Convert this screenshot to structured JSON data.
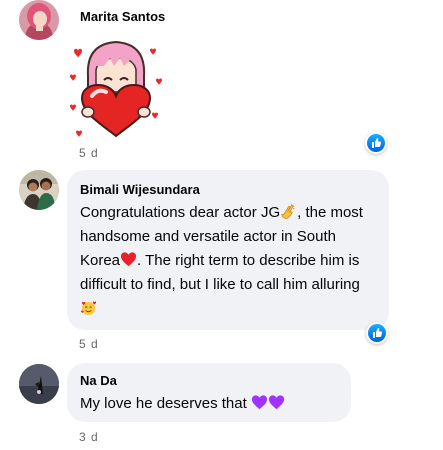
{
  "comments": [
    {
      "author": "Marita Santos",
      "sticker": "heart-hug-sticker",
      "time": "5 d",
      "reaction": "like"
    },
    {
      "author": "Bimali Wijesundara",
      "text_part1": "Congratulations dear actor JG",
      "emoji1": "clapping-hands-emoji",
      "text_part2": ", the most handsome and versatile actor in South Korea",
      "emoji2": "red-heart-emoji",
      "text_part3": ". The right term to describe him is difficult to find, but I like to call him alluring ",
      "emoji3": "smiling-face-with-hearts-emoji",
      "time": "5 d",
      "reaction": "like"
    },
    {
      "author": "Na Da",
      "text_part1": "My love he deserves that ",
      "emoji1": "purple-heart-emoji",
      "time": "3 d"
    }
  ],
  "colors": {
    "bubble": "#f0f2f5",
    "like_blue": "#0866ff",
    "meta_gray": "#65676b",
    "purple_heart": "#a033ff",
    "red_heart": "#e8202a"
  }
}
